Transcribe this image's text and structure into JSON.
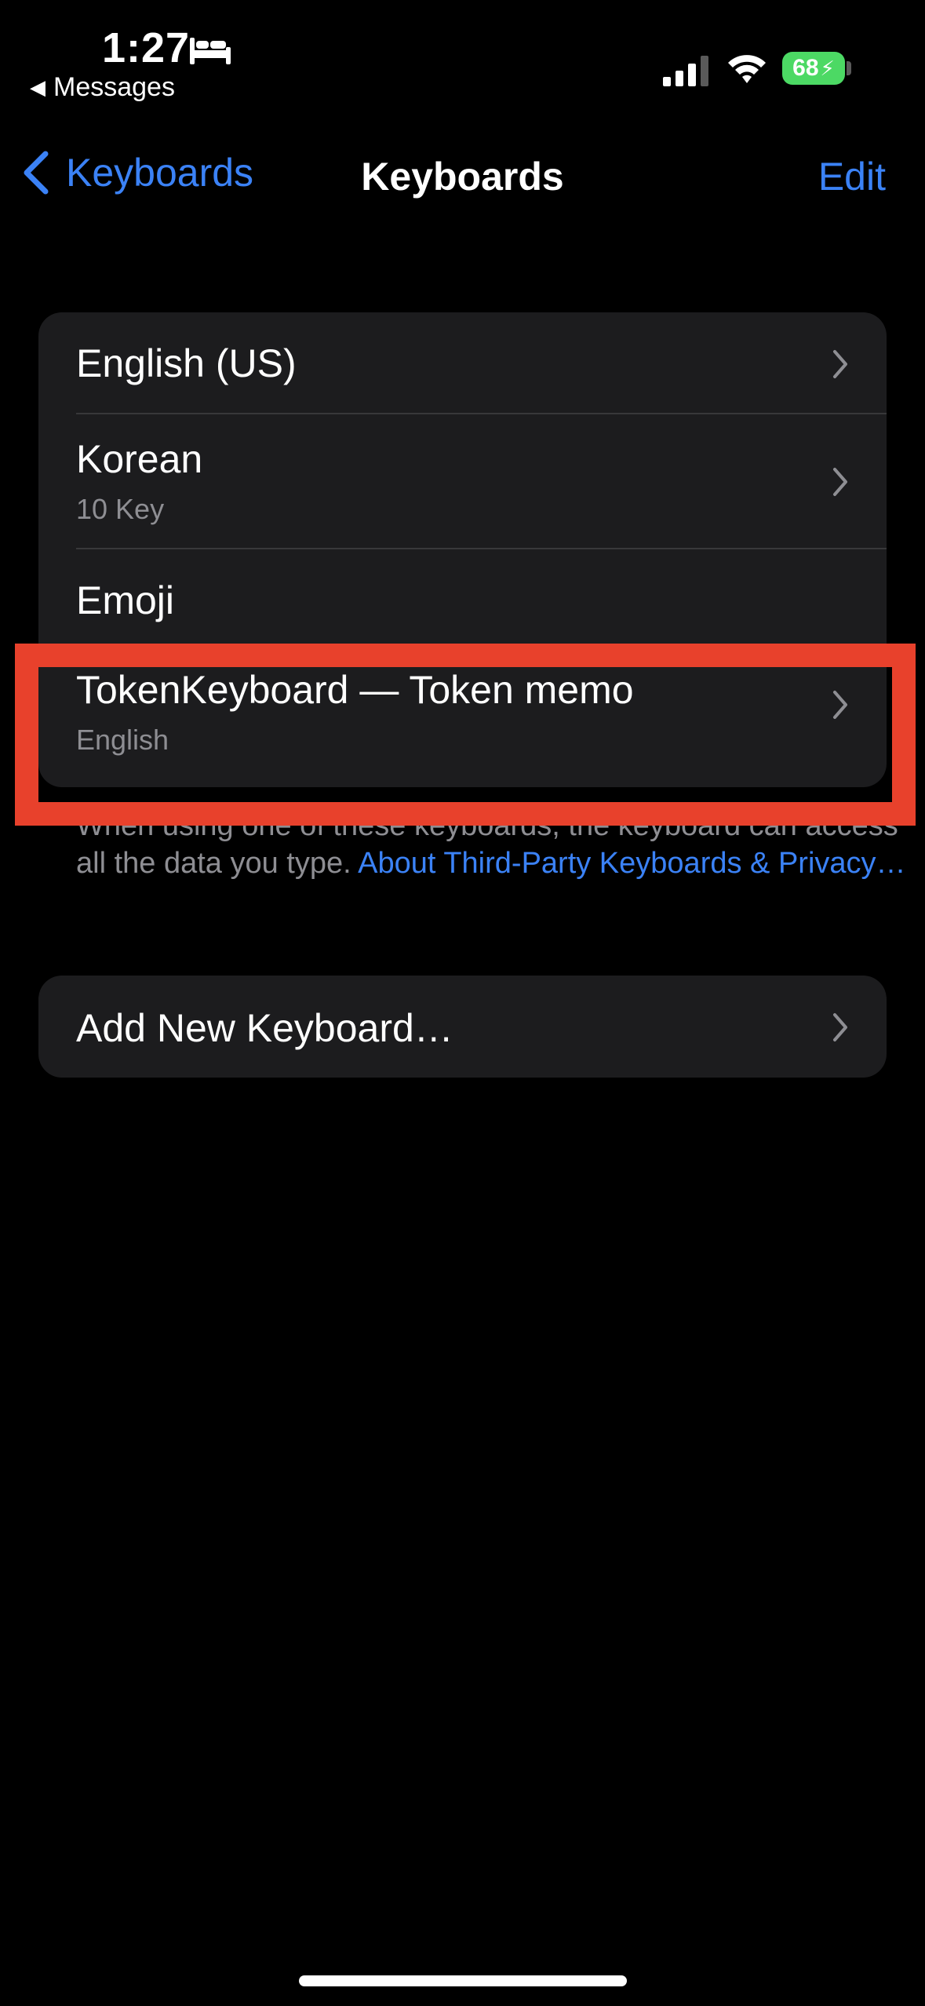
{
  "status_bar": {
    "time": "1:27",
    "back_app": "Messages",
    "battery": "68"
  },
  "nav": {
    "back_label": "Keyboards",
    "title": "Keyboards",
    "edit_label": "Edit"
  },
  "keyboards": [
    {
      "name": "English (US)",
      "sub": ""
    },
    {
      "name": "Korean",
      "sub": "10 Key"
    },
    {
      "name": "Emoji",
      "sub": ""
    },
    {
      "name": "TokenKeyboard — Token memo",
      "sub": "English"
    }
  ],
  "footer": {
    "text": "When using one of these keyboards, the keyboard can access all the data you type.",
    "link": "About Third-Party Keyboards & Privacy…"
  },
  "add_keyboard": "Add New Keyboard…",
  "colors": {
    "accent": "#3b82f6",
    "highlight": "#e8412c",
    "battery": "#4cd964"
  },
  "icons": [
    "bed-icon",
    "signal-icon",
    "wifi-icon",
    "battery-icon",
    "chevron-left-icon",
    "chevron-right-icon"
  ]
}
